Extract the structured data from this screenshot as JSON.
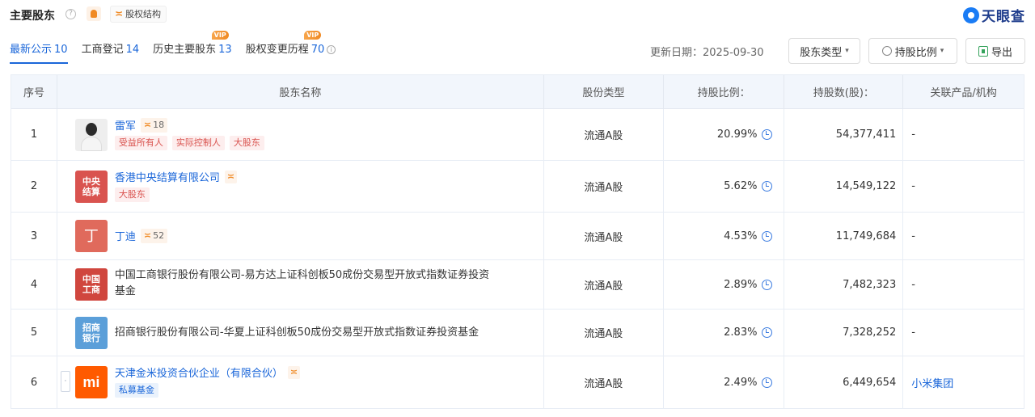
{
  "header": {
    "title": "主要股东",
    "info_glyph": "?",
    "equity_button": "股权结构",
    "equity_glyph": "≍",
    "brand_name": "天眼查"
  },
  "tabs": [
    {
      "label": "最新公示",
      "count": "10",
      "active": true
    },
    {
      "label": "工商登记",
      "count": "14"
    },
    {
      "label": "历史主要股东",
      "count": "13",
      "badge": "VIP"
    },
    {
      "label": "股权变更历程",
      "count": "70",
      "badge": "VIP",
      "info_glyph": "i"
    }
  ],
  "toolbar": {
    "update_date": "更新日期：2025-09-30",
    "shareholder_type": "股东类型",
    "holding_ratio": "持股比例",
    "export": "导出",
    "caret": "▾"
  },
  "table": {
    "headers": [
      "序号",
      "股东名称",
      "股份类型",
      "持股比例：",
      "持股数(股)：",
      "关联产品/机构"
    ],
    "rows": [
      {
        "idx": "1",
        "name": "雷军",
        "rank": "18",
        "tags": [
          "受益所有人",
          "实际控制人",
          "大股东"
        ],
        "type": "流通A股",
        "ratio": "20.99%",
        "shares": "54,377,411",
        "related": "-"
      },
      {
        "idx": "2",
        "name": "香港中央结算有限公司",
        "avatar": "中央\n结算",
        "tags": [
          "大股东"
        ],
        "type": "流通A股",
        "ratio": "5.62%",
        "shares": "14,549,122",
        "related": "-"
      },
      {
        "idx": "3",
        "name": "丁迪",
        "avatar": "丁",
        "rank": "52",
        "type": "流通A股",
        "ratio": "4.53%",
        "shares": "11,749,684",
        "related": "-"
      },
      {
        "idx": "4",
        "name": "中国工商银行股份有限公司-易方达上证科创板50成份交易型开放式指数证券投资",
        "name2": "基金",
        "avatar": "中国\n工商",
        "type": "流通A股",
        "ratio": "2.89%",
        "shares": "7,482,323",
        "related": "-"
      },
      {
        "idx": "5",
        "name": "招商银行股份有限公司-华夏上证科创板50成份交易型开放式指数证券投资基金",
        "avatar": "招商\n银行",
        "type": "流通A股",
        "ratio": "2.83%",
        "shares": "7,328,252",
        "related": "-"
      },
      {
        "idx": "6",
        "name": "天津金米投资合伙企业（有限合伙）",
        "avatar": "mi",
        "tags": [
          "私募基金"
        ],
        "type": "流通A股",
        "ratio": "2.49%",
        "shares": "6,449,654",
        "related": "小米集团",
        "expander": "·"
      }
    ]
  },
  "colors": {
    "accent": "#1a66d9",
    "tag_red": "#d9534f",
    "vip_orange": "#f08a24"
  },
  "icons": [
    "info-icon",
    "shield-badge-icon",
    "structure-icon",
    "tianyancha-logo-icon",
    "history-icon",
    "excel-icon",
    "chevron-down-icon",
    "clock-icon"
  ]
}
